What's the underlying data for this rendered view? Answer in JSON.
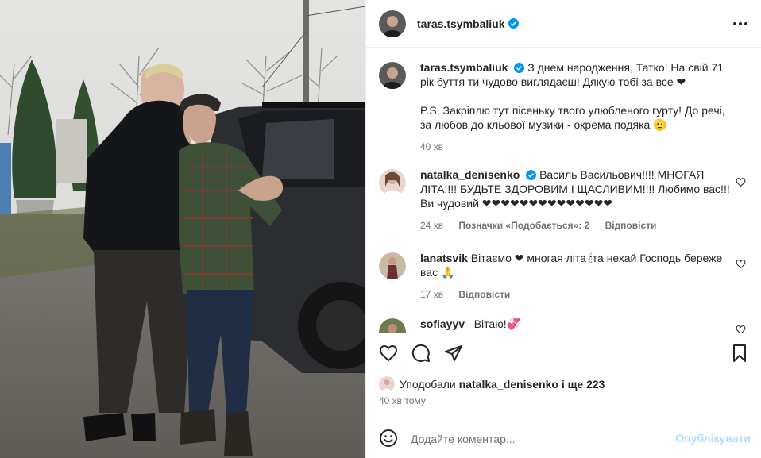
{
  "post": {
    "author": "taras.tsymbaliuk",
    "caption": "З днем народження, Татко! На свій 71 рік буття ти чудово виглядаєш! Дякую тобі за все ❤",
    "caption_ps": "P.S. Закріплю тут пісеньку твого улюбленого гурту! До речі, за любов до кльової музики - окрема подяка 🫡",
    "caption_time": "40 хв"
  },
  "comments": [
    {
      "user": "natalka_denisenko",
      "text": "Василь Васильович!!!! МНОГАЯ ЛІТА!!!! БУДЬТЕ ЗДОРОВИМ І ЩАСЛИВИМ!!!! Любимо вас!!! Ви чудовий ❤❤❤❤❤❤❤❤❤❤❤❤❤❤",
      "time": "24 хв",
      "likes": "Позначки «Подобається»: 2",
      "reply": "Відповісти"
    },
    {
      "user": "lanatsvik",
      "text": "Вітаємо ❤ многая літа 🕯та нехай Господь береже вас 🙏",
      "time": "17 хв",
      "reply": "Відповісти"
    },
    {
      "user": "sofiayyv_",
      "text": "Вітаю!💞"
    }
  ],
  "liked_by": {
    "prefix": "Уподобали",
    "user": "natalka_denisenko",
    "suffix": "і ще 223"
  },
  "post_time": "40 хв тому",
  "composer": {
    "placeholder": "Додайте коментар...",
    "post_label": "Опублікувати"
  },
  "colors": {
    "verified": "#0095f6",
    "muted": "#737373",
    "post_button_disabled": "#b3dbff"
  }
}
